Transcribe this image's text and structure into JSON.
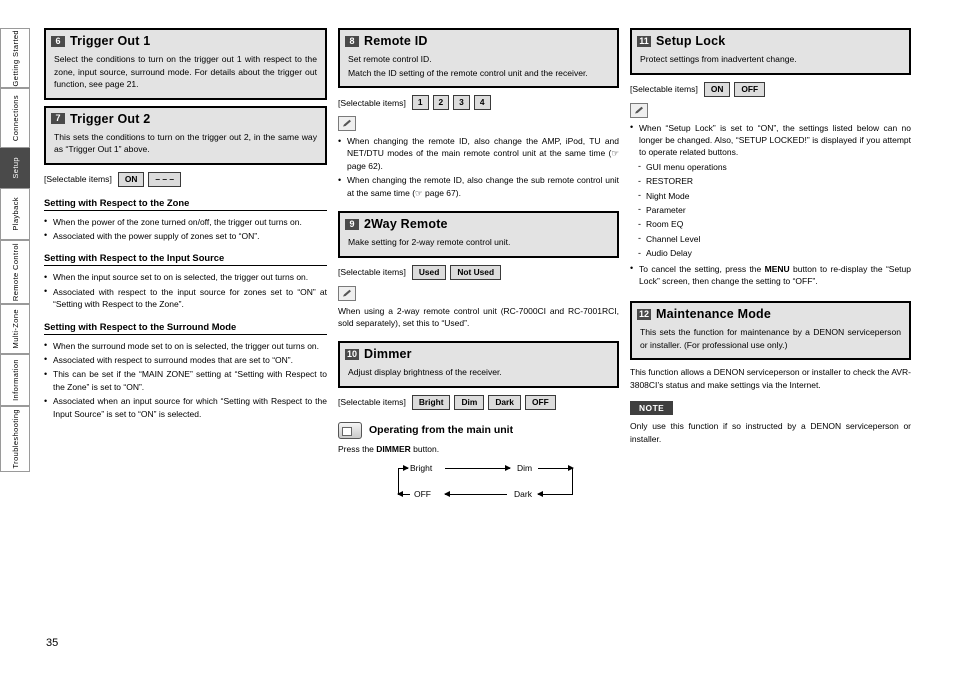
{
  "page": {
    "number": "35"
  },
  "tabs": [
    {
      "label": "Getting Started",
      "active": false
    },
    {
      "label": "Connections",
      "active": false
    },
    {
      "label": "Setup",
      "active": true
    },
    {
      "label": "Playback",
      "active": false
    },
    {
      "label": "Remote Control",
      "active": false
    },
    {
      "label": "Multi-Zone",
      "active": false
    },
    {
      "label": "Information",
      "active": false
    },
    {
      "label": "Troubleshooting",
      "active": false
    }
  ],
  "col1": {
    "trigger1": {
      "num": "6",
      "title": "Trigger Out 1",
      "body": "Select the conditions to turn on the trigger out 1 with respect to the zone, input source, surround mode. For details about the trigger out function, see page 21."
    },
    "trigger2": {
      "num": "7",
      "title": "Trigger Out 2",
      "body": "This sets the conditions to turn on the trigger out 2, in the same way as “Trigger Out 1” above."
    },
    "selectable": {
      "label": "[Selectable items]",
      "items": [
        "ON",
        "– – –"
      ]
    },
    "zone": {
      "heading": "Setting with Respect to the Zone",
      "bullets": [
        "When the power of the zone turned on/off, the trigger out turns on.",
        "Associated with the power supply of zones set to “ON”."
      ]
    },
    "input": {
      "heading": "Setting with Respect to the Input Source",
      "bullets": [
        "When the input source set to on is selected, the trigger out turns on.",
        "Associated with respect to the input source for zones set to “ON” at “Setting with Respect to the Zone”."
      ]
    },
    "surround": {
      "heading": "Setting with Respect to the Surround Mode",
      "bullets": [
        "When the surround mode set to on is selected, the trigger out turns on.",
        "Associated with respect to surround modes that are set to “ON”.",
        "This can be set if the “MAIN ZONE” setting at “Setting with Respect to the Zone” is set to “ON”.",
        "Associated when an input source for which “Setting with Respect to the Input Source” is set to “ON” is selected."
      ]
    }
  },
  "col2": {
    "remoteid": {
      "num": "8",
      "title": "Remote ID",
      "body1": "Set remote control ID.",
      "body2": "Match the ID setting of the remote control unit and the receiver.",
      "selectable": {
        "label": "[Selectable items]",
        "items": [
          "1",
          "2",
          "3",
          "4"
        ]
      },
      "notes": [
        "When changing the remote ID, also change the AMP, iPod, TU and NET/DTU modes of the main remote control unit at the same time (☞ page 62).",
        "When changing the remote ID, also change the sub remote control unit at the same time (☞ page 67)."
      ]
    },
    "twoway": {
      "num": "9",
      "title": "2Way Remote",
      "body": "Make setting for 2-way remote control unit.",
      "selectable": {
        "label": "[Selectable items]",
        "items": [
          "Used",
          "Not Used"
        ]
      },
      "note": "When using a 2-way remote control unit (RC-7000CI and RC-7001RCI, sold separately), set this to “Used”."
    },
    "dimmer": {
      "num": "10",
      "title": "Dimmer",
      "body": "Adjust display brightness of the receiver.",
      "selectable": {
        "label": "[Selectable items]",
        "items": [
          "Bright",
          "Dim",
          "Dark",
          "OFF"
        ]
      },
      "operating": {
        "title": "Operating from the  main unit",
        "instruction_pre": "Press the ",
        "instruction_key": "DIMMER",
        "instruction_post": " button.",
        "flow": [
          "Bright",
          "Dim",
          "Dark",
          "OFF"
        ]
      }
    }
  },
  "col3": {
    "setuplock": {
      "num": "11",
      "title": "Setup Lock",
      "body": "Protect settings from inadvertent change.",
      "selectable": {
        "label": "[Selectable items]",
        "items": [
          "ON",
          "OFF"
        ]
      },
      "notes": [
        "When “Setup Lock” is set to “ON”, the settings listed below can no longer be changed. Also, “SETUP LOCKED!” is displayed if you attempt to operate related buttons."
      ],
      "sublist": [
        "GUI menu operations",
        "RESTORER",
        "Night Mode",
        "Parameter",
        "Room EQ",
        "Channel Level",
        "Audio Delay"
      ],
      "note_after_pre": "To cancel the setting, press the ",
      "note_after_key": "MENU",
      "note_after_post": " button to re-display the “Setup Lock” screen, then change the setting to “OFF”."
    },
    "maintenance": {
      "num": "12",
      "title": "Maintenance Mode",
      "body": "This sets the function for maintenance by a DENON serviceperson or installer. (For professional use only.)",
      "para": "This function allows a DENON serviceperson or installer to check the AVR-3808CI’s status and make settings via the Internet.",
      "note_badge": "NOTE",
      "note_text": "Only use this function if so instructed by a DENON serviceperson or installer."
    }
  }
}
